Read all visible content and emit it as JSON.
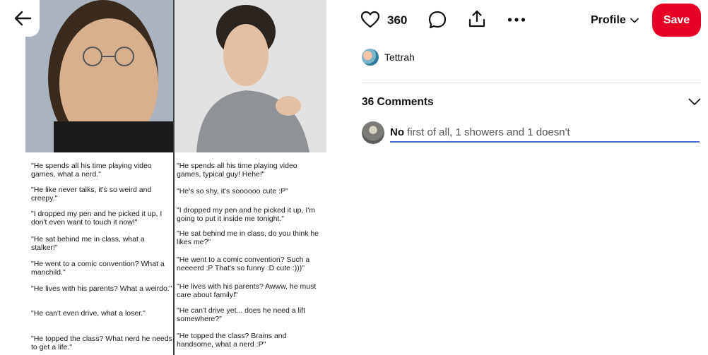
{
  "pin": {
    "captions_left": [
      "\"He spends all his time playing video games, what a              nerd.\"",
      "\"He like never talks, it's so weird and creepy.\"",
      "\"I dropped my pen and he picked it up, I don't even want to touch it now!\"",
      "\"He sat behind me in class, what a               stalker!\"",
      "\"He went to a comic convention? What a              manchild.\"",
      "\"He lives with his parents? What a              weirdo.\"",
      "\"He can't even drive, what a loser.\"",
      "\"He topped the class? What nerd he needs to get a life.\""
    ],
    "captions_right": [
      "\"He spends all his time playing video games, typical guy! Hehe!\"",
      "\"He's so shy, it's soooooo cute :P\"",
      "\"I dropped my pen and he picked it up, I'm going to put it inside me tonight.\"",
      "\"He sat behind me in class, do you think he likes me?\"",
      "\"He went to a comic convention? Such a neeeerd :P That's so funny :D cute :)))\"",
      "\"He lives with his parents? Awww, he must care about family!\"",
      "\"He can't drive yet... does he need a lift somewhere?\"",
      "\"He topped the class? Brains and handsome, what a nerd :P\""
    ]
  },
  "actions": {
    "like_count": "360",
    "profile_label": "Profile",
    "save_label": "Save"
  },
  "creator": {
    "name": "Tettrah"
  },
  "comments": {
    "count_label": "36 Comments",
    "draft_bold": "No",
    "draft_rest": " first of all, 1 showers and 1 doesn't"
  },
  "colors": {
    "save": "#e60023",
    "input_underline": "#4a6bd8"
  }
}
